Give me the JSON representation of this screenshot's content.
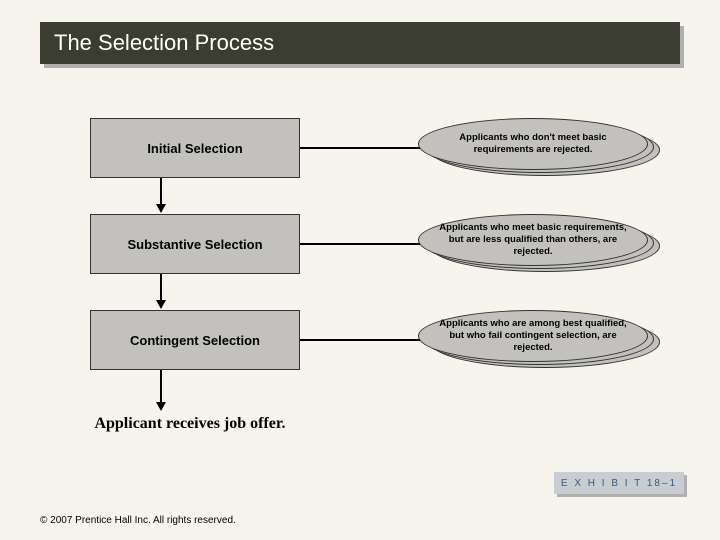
{
  "title": "The Selection Process",
  "stages": [
    {
      "label": "Initial Selection",
      "note": "Applicants who don't meet basic requirements are rejected."
    },
    {
      "label": "Substantive Selection",
      "note": "Applicants who meet basic requirements, but are less qualified than others, are rejected."
    },
    {
      "label": "Contingent Selection",
      "note": "Applicants who are among best qualified, but who fail contingent selection, are rejected."
    }
  ],
  "final": "Applicant receives job offer.",
  "exhibit": "E X H I B I T  18–1",
  "copyright": "© 2007 Prentice Hall Inc. All rights reserved."
}
